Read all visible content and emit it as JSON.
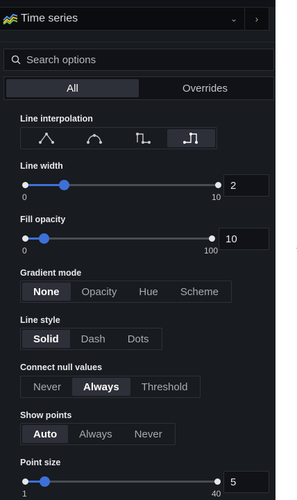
{
  "viz_picker": {
    "name": "Time series"
  },
  "search": {
    "placeholder": "Search options"
  },
  "tabs": {
    "all": "All",
    "overrides": "Overrides"
  },
  "line_interpolation": {
    "label": "Line interpolation",
    "options": [
      "linear",
      "smooth",
      "step-before",
      "step-after"
    ],
    "selected": 3
  },
  "line_width": {
    "label": "Line width",
    "min": "0",
    "max": "10",
    "value": "2"
  },
  "fill_opacity": {
    "label": "Fill opacity",
    "min": "0",
    "max": "100",
    "value": "10"
  },
  "gradient_mode": {
    "label": "Gradient mode",
    "options": [
      "None",
      "Opacity",
      "Hue",
      "Scheme"
    ],
    "selected": 0
  },
  "line_style": {
    "label": "Line style",
    "options": [
      "Solid",
      "Dash",
      "Dots"
    ],
    "selected": 0
  },
  "connect_null": {
    "label": "Connect null values",
    "options": [
      "Never",
      "Always",
      "Threshold"
    ],
    "selected": 1
  },
  "show_points": {
    "label": "Show points",
    "options": [
      "Auto",
      "Always",
      "Never"
    ],
    "selected": 0
  },
  "point_size": {
    "label": "Point size",
    "min": "1",
    "max": "40",
    "value": "5"
  },
  "colors": {
    "panel": "#181b1f",
    "accent": "#3d71d9",
    "selected_bg": "#2d3038"
  }
}
